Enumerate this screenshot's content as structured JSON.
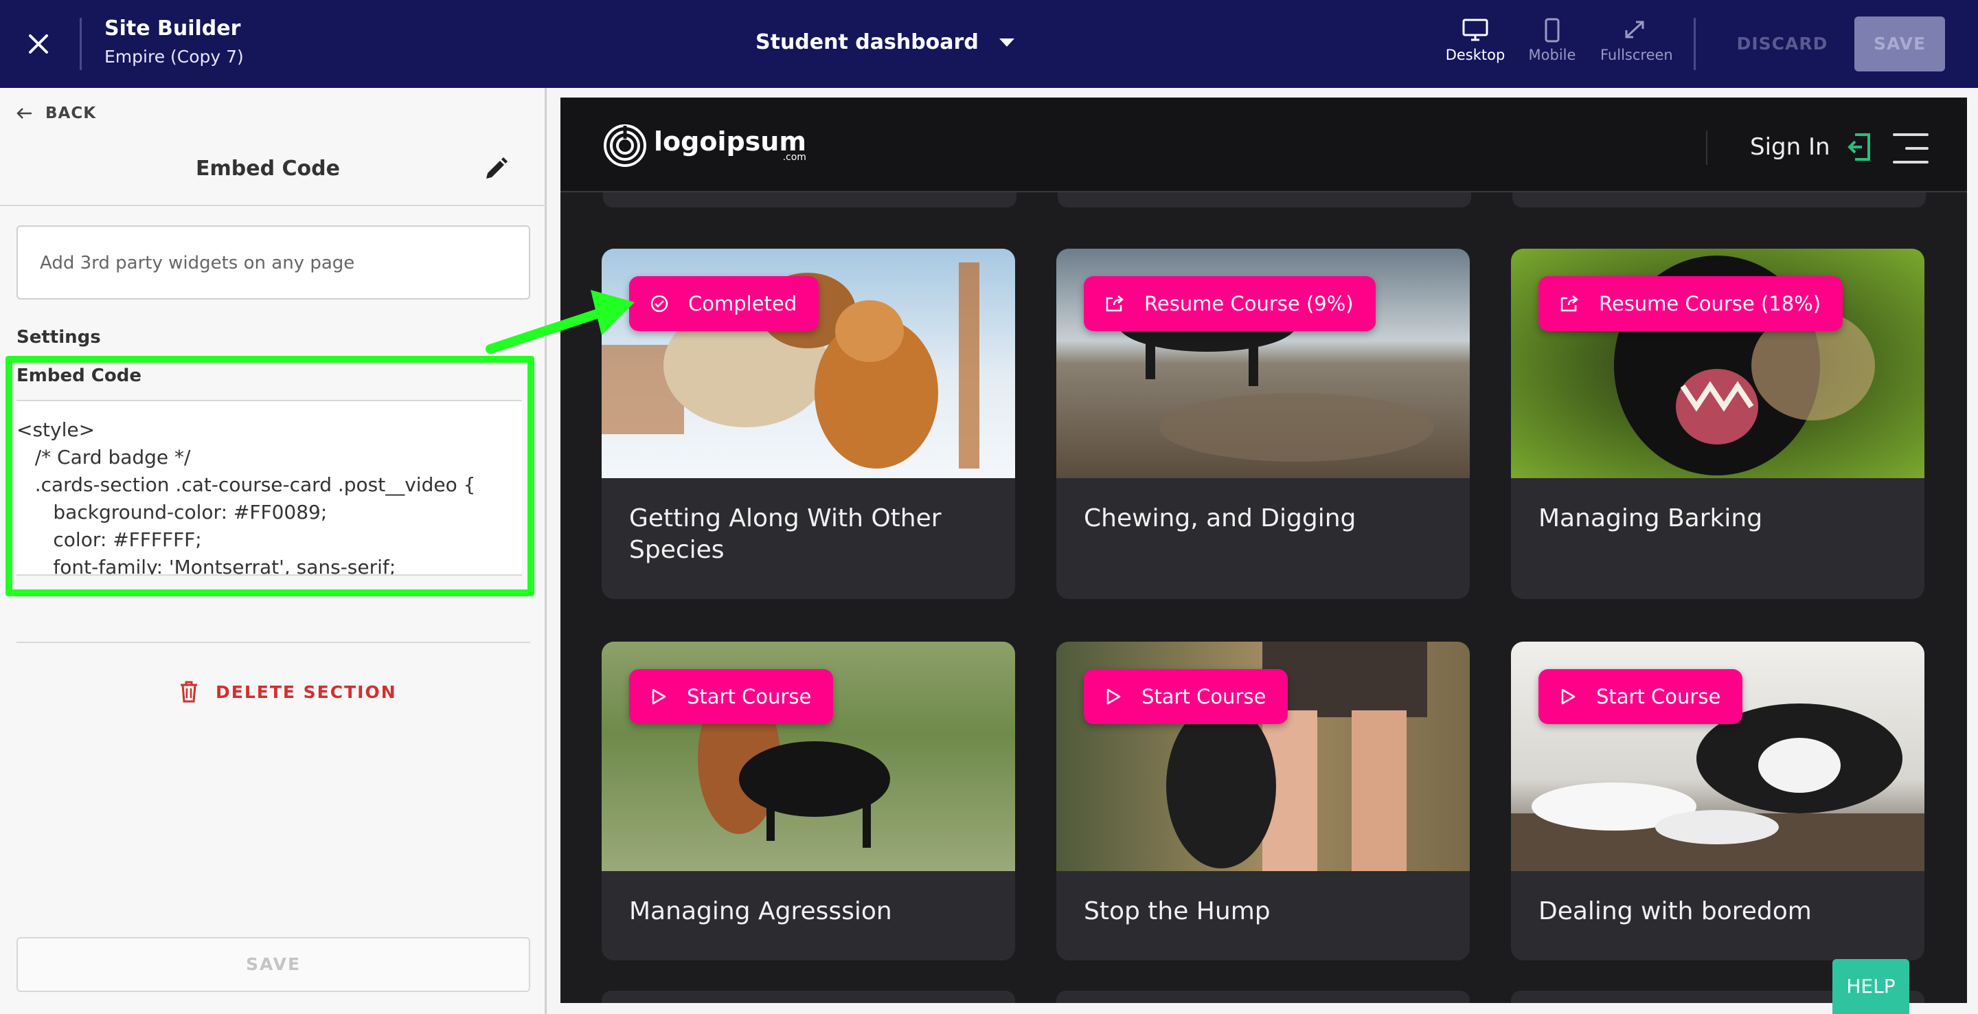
{
  "topbar": {
    "app_title": "Site Builder",
    "app_subtitle": "Empire (Copy 7)",
    "page_select": "Student dashboard",
    "views": [
      {
        "label": "Desktop",
        "icon": "desktop-icon",
        "active": true
      },
      {
        "label": "Mobile",
        "icon": "mobile-icon",
        "active": false
      },
      {
        "label": "Fullscreen",
        "icon": "fullscreen-icon",
        "active": false
      }
    ],
    "discard_label": "DISCARD",
    "save_label": "SAVE"
  },
  "panel": {
    "back_label": "BACK",
    "title": "Embed Code",
    "description_placeholder": "Add 3rd party widgets on any page",
    "settings_label": "Settings",
    "embed_label": "Embed Code",
    "code_lines": [
      "<style>",
      "   /* Card badge */",
      "   .cards-section .cat-course-card .post__video {",
      "      background-color: #FF0089;",
      "      color: #FFFFFF;",
      "      font-family: 'Montserrat', sans-serif;",
      "   }"
    ],
    "delete_label": "DELETE SECTION",
    "save_label": "SAVE",
    "highlight_color": "#22ff22"
  },
  "preview": {
    "logo_text": "logoipsum",
    "logo_sub": ".com",
    "signin_label": "Sign In",
    "badge_color": "#ff0089",
    "cards": [
      {
        "title": "Getting Along With Other Species",
        "badge": "Completed",
        "badge_icon": "check-circle-icon"
      },
      {
        "title": "Chewing, and Digging",
        "badge": "Resume Course (9%)",
        "badge_icon": "share-icon"
      },
      {
        "title": "Managing Barking",
        "badge": "Resume Course (18%)",
        "badge_icon": "share-icon"
      },
      {
        "title": "Managing Agresssion",
        "badge": "Start Course",
        "badge_icon": "play-icon"
      },
      {
        "title": "Stop the Hump",
        "badge": "Start Course",
        "badge_icon": "play-icon"
      },
      {
        "title": "Dealing with boredom",
        "badge": "Start Course",
        "badge_icon": "play-icon"
      }
    ]
  },
  "help_label": "HELP"
}
